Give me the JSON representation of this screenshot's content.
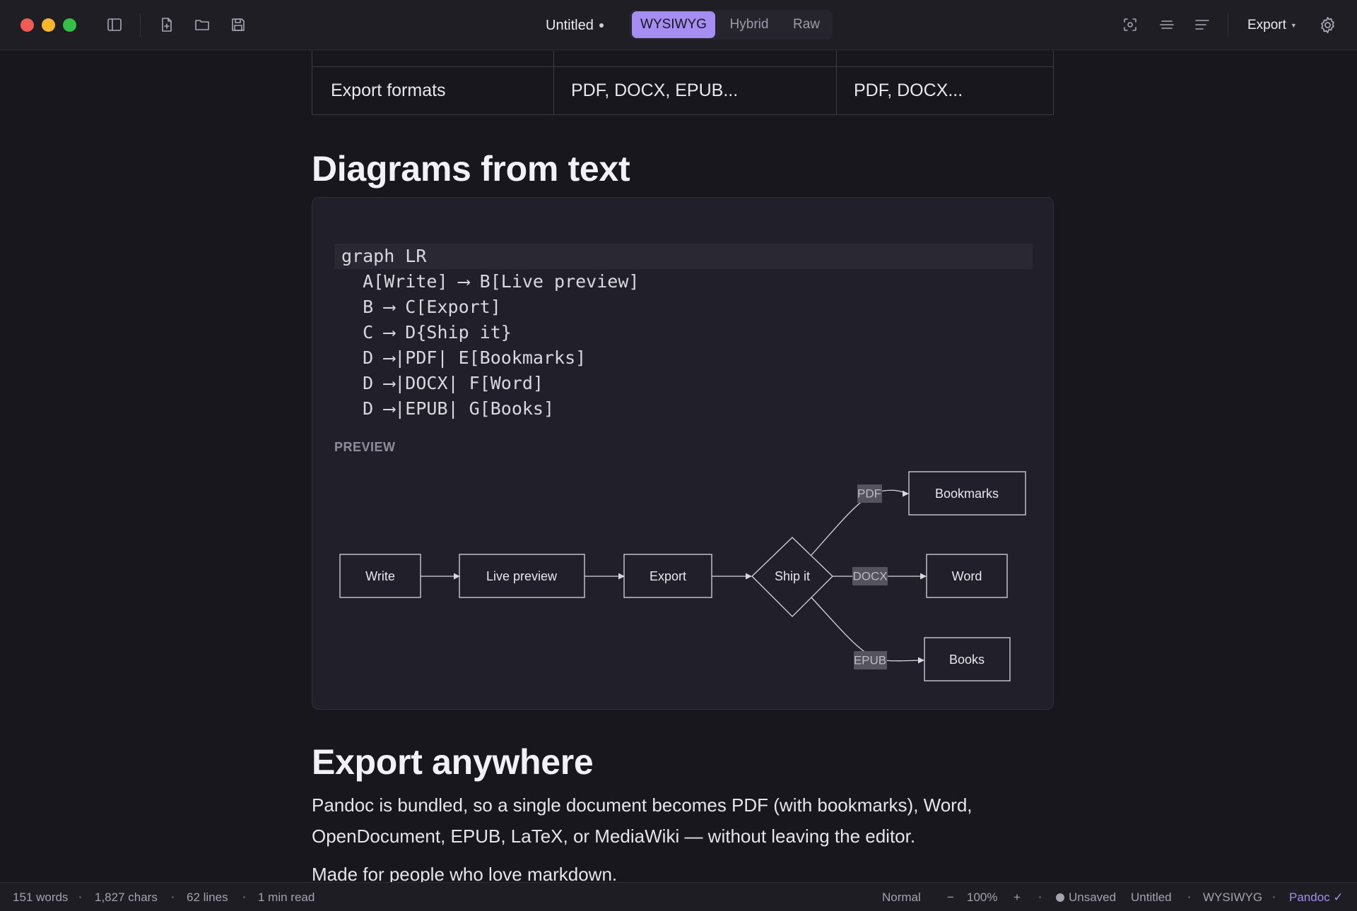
{
  "toolbar": {
    "doc_title": "Untitled",
    "modes": [
      "WYSIWYG",
      "Hybrid",
      "Raw"
    ],
    "active_mode": "WYSIWYG",
    "export_label": "Export",
    "icons": [
      "sidebar-toggle-icon",
      "new-file-icon",
      "open-folder-icon",
      "save-icon",
      "focus-mode-icon",
      "typewriter-mode-icon",
      "outline-icon",
      "settings-icon"
    ]
  },
  "table": {
    "row": {
      "feature": "Export formats",
      "col2": "PDF, DOCX, EPUB...",
      "col3": "PDF, DOCX..."
    }
  },
  "sections": {
    "diagrams_heading": "Diagrams from text",
    "export_heading": "Export anywhere"
  },
  "code": {
    "lines": [
      "graph LR",
      "  A[Write] ⟶ B[Live preview]",
      "  B ⟶ C[Export]",
      "  C ⟶ D{Ship it}",
      "  D ⟶|PDF| E[Bookmarks]",
      "  D ⟶|DOCX| F[Word]",
      "  D ⟶|EPUB| G[Books]"
    ],
    "preview_label": "PREVIEW"
  },
  "diagram": {
    "nodes": {
      "write": "Write",
      "live_preview": "Live preview",
      "export": "Export",
      "ship_it": "Ship it",
      "bookmarks": "Bookmarks",
      "word": "Word",
      "books": "Books"
    },
    "edge_labels": {
      "pdf": "PDF",
      "docx": "DOCX",
      "epub": "EPUB"
    }
  },
  "body": {
    "paragraph": "Pandoc is bundled, so a single document becomes PDF (with bookmarks), Word, OpenDocument, EPUB, LaTeX, or MediaWiki — without leaving the editor.",
    "tagline": "Made for people who love markdown."
  },
  "status": {
    "words": "151 words",
    "chars": "1,827 chars",
    "lines": "62 lines",
    "read_time": "1 min read",
    "style": "Normal",
    "zoom_minus": "−",
    "zoom": "100%",
    "zoom_plus": "+",
    "save_state": "Unsaved",
    "file_name": "Untitled",
    "mode": "WYSIWYG",
    "engine": "Pandoc ✓"
  },
  "colors": {
    "accent": "#a58df2",
    "background": "#18171d",
    "card": "#211f29"
  }
}
